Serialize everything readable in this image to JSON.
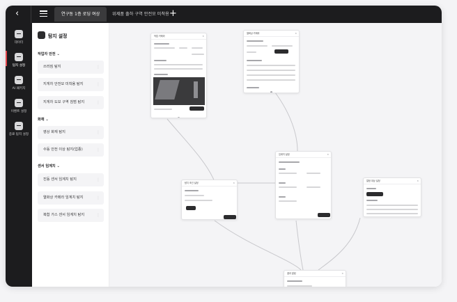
{
  "header": {
    "tabs": [
      {
        "label": "연구동 1층 로딩 여상",
        "active": true
      },
      {
        "label": "위제품 출하 구역 안전모 미착용",
        "active": false
      }
    ]
  },
  "rail": {
    "items": [
      {
        "label": "데이터",
        "icon": "database-icon",
        "active": false
      },
      {
        "label": "탐지 설정",
        "icon": "detection-icon",
        "active": true
      },
      {
        "label": "AI 패키지",
        "icon": "package-icon",
        "active": false
      },
      {
        "label": "이벤트 설정",
        "icon": "filter-icon",
        "active": false
      },
      {
        "label": "종료 탐지 설정",
        "icon": "home-icon",
        "active": false
      }
    ]
  },
  "panel": {
    "title": "탐지 설정",
    "sections": [
      {
        "label": "작업자 안전",
        "items": [
          "쓰러짐 탐지",
          "지게차 안전모 미착용 탐지",
          "지게차 도보 구역 침범 탐지"
        ]
      },
      {
        "label": "화재",
        "items": [
          "영상 화재 탐지",
          "수동 안전 이상 탐지(업종)"
        ]
      },
      {
        "label": "센서 임계치",
        "items": [
          "진동 센서 임계치 탐지",
          "열화상 카메라 임계치 탐지",
          "복합 가스 센서 임계치 탐지"
        ]
      }
    ]
  },
  "canvas": {
    "nodes": [
      {
        "id": "n1",
        "title": "작업 카메라"
      },
      {
        "id": "n2",
        "title": "열화상 카메라"
      },
      {
        "id": "n3",
        "title": "탐지 조건 설정"
      },
      {
        "id": "n4",
        "title": "임계치 설정"
      },
      {
        "id": "n5",
        "title": "알람 대상 설정"
      },
      {
        "id": "n6",
        "title": "결과 알림"
      }
    ]
  },
  "colors": {
    "dark": "#1c1c1e",
    "accent": "#e5484d",
    "canvas": "#f4f4f6"
  }
}
